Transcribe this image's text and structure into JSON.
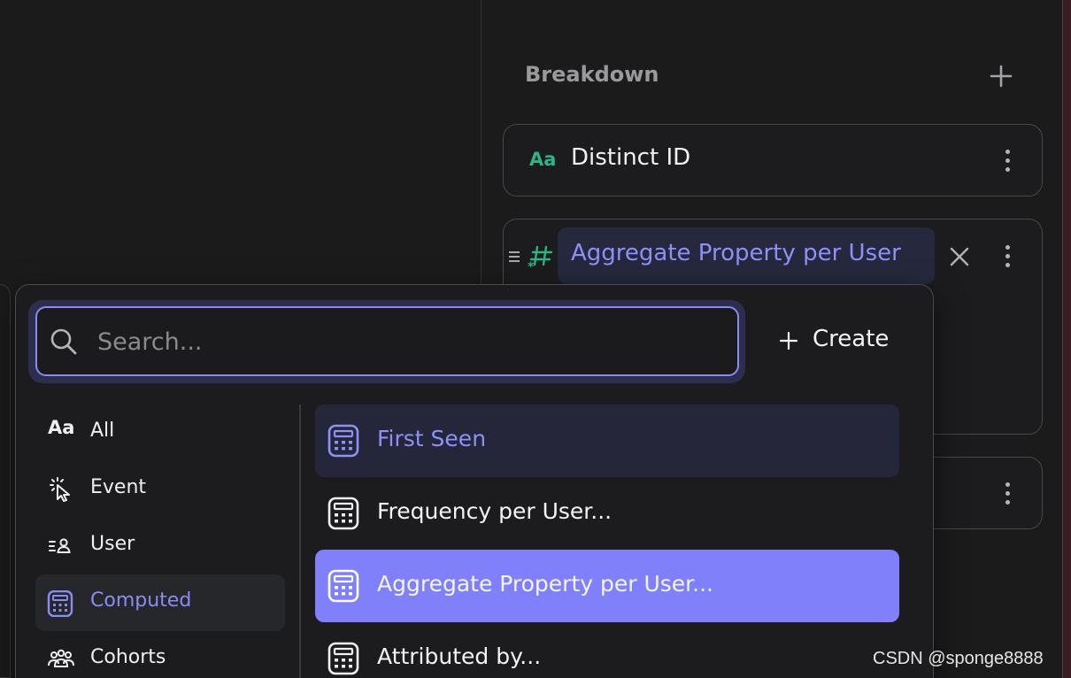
{
  "breakdown": {
    "title": "Breakdown",
    "cards": [
      {
        "icon": "text-type-icon",
        "glyph": "Aa",
        "label": "Distinct ID"
      },
      {
        "icon": "computed-number-icon",
        "label": "Aggregate Property per User"
      }
    ]
  },
  "popover": {
    "search": {
      "placeholder": "Search...",
      "value": ""
    },
    "create_label": "Create",
    "categories": [
      {
        "icon": "text-type-icon",
        "glyph": "Aa",
        "label": "All"
      },
      {
        "icon": "cursor-click-icon",
        "label": "Event"
      },
      {
        "icon": "user-list-icon",
        "label": "User"
      },
      {
        "icon": "calculator-icon",
        "label": "Computed",
        "active": true
      },
      {
        "icon": "cohorts-icon",
        "label": "Cohorts"
      }
    ],
    "properties": [
      {
        "icon": "calculator-icon",
        "label": "First Seen"
      },
      {
        "icon": "calculator-icon",
        "label": "Frequency per User..."
      },
      {
        "icon": "calculator-icon",
        "label": "Aggregate Property per User...",
        "selected": true
      },
      {
        "icon": "calculator-icon",
        "label": "Attributed by..."
      }
    ]
  },
  "watermark": "CSDN @sponge8888",
  "colors": {
    "accent": "#8080fb",
    "accent_text": "#8f8ff8",
    "text_type_green": "#2fb383",
    "background": "#1b1b1c"
  }
}
